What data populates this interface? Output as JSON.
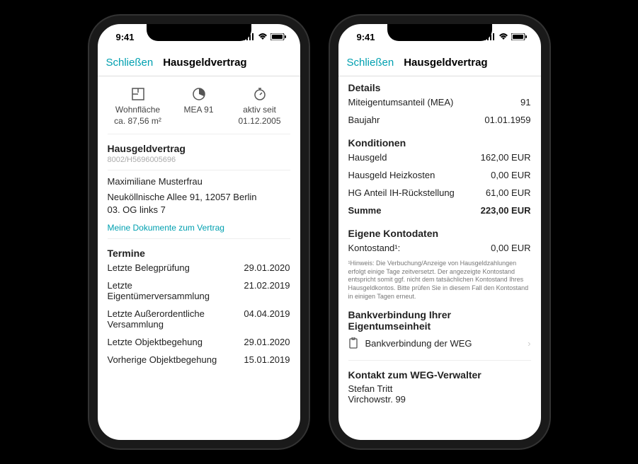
{
  "status": {
    "time": "9:41"
  },
  "nav": {
    "close": "Schließen",
    "title": "Hausgeldvertrag"
  },
  "stats": {
    "area_label": "Wohnfläche",
    "area_value": "ca. 87,56 m²",
    "mea_label": "MEA 91",
    "active_label": "aktiv seit",
    "active_value": "01.12.2005"
  },
  "contract": {
    "heading": "Hausgeldvertrag",
    "id": "8002/H5696005696",
    "holder": "Maximiliane Musterfrau",
    "address_line1": "Neuköllnische Allee 91, 12057 Berlin",
    "address_line2": "03. OG links 7",
    "doc_link": "Meine Dokumente zum Vertrag"
  },
  "dates": {
    "heading": "Termine",
    "rows": [
      {
        "label": "Letzte Belegprüfung",
        "value": "29.01.2020"
      },
      {
        "label": "Letzte Eigentümerversammlung",
        "value": "21.02.2019"
      },
      {
        "label": "Letzte Außerordentliche Versammlung",
        "value": "04.04.2019"
      },
      {
        "label": "Letzte Objektbegehung",
        "value": "29.01.2020"
      },
      {
        "label": "Vorherige Objektbegehung",
        "value": "15.01.2019"
      }
    ]
  },
  "details": {
    "heading": "Details",
    "rows": [
      {
        "label": "Miteigentumsanteil (MEA)",
        "value": "91"
      },
      {
        "label": "Baujahr",
        "value": "01.01.1959"
      }
    ]
  },
  "conditions": {
    "heading": "Konditionen",
    "rows": [
      {
        "label": "Hausgeld",
        "value": "162,00 EUR"
      },
      {
        "label": "Hausgeld Heizkosten",
        "value": "0,00 EUR"
      },
      {
        "label": "HG Anteil IH-Rückstellung",
        "value": "61,00 EUR"
      }
    ],
    "sum_label": "Summe",
    "sum_value": "223,00 EUR"
  },
  "account": {
    "heading": "Eigene Kontodaten",
    "balance_label": "Kontostand¹:",
    "balance_value": "0,00 EUR",
    "hint": "¹Hinweis: Die Verbuchung/Anzeige von Hausgeldzahlungen erfolgt einige Tage zeitversetzt. Der angezeigte Kontostand entspricht somit ggf. nicht dem tatsächlichen Kontostand Ihres Hausgeldkontos. Bitte prüfen Sie in diesem Fall den Kontostand in einigen Tagen erneut."
  },
  "bank": {
    "heading": "Bankverbindung Ihrer Eigentumseinheit",
    "entry": "Bankverbindung der WEG"
  },
  "contact": {
    "heading": "Kontakt zum WEG-Verwalter",
    "name": "Stefan Tritt",
    "address": "Virchowstr. 99"
  }
}
